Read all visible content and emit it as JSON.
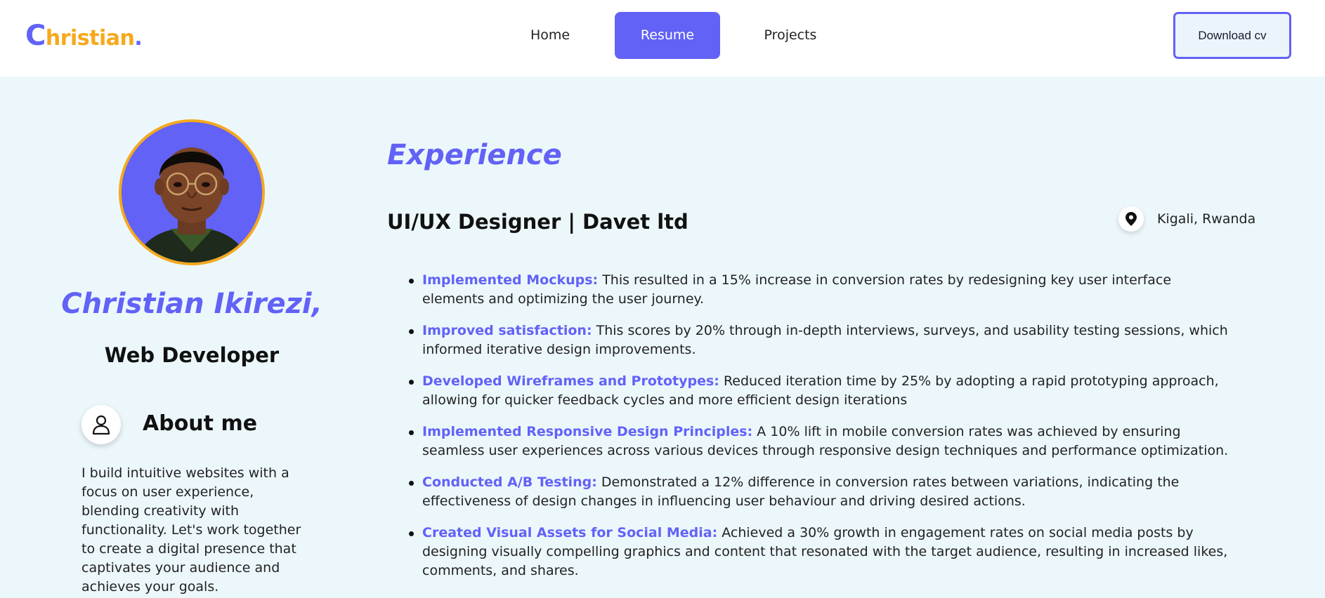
{
  "brand": {
    "logo_first": "C",
    "logo_rest": "hristian",
    "logo_dot": ".",
    "primary_color": "#6262f7",
    "accent_color": "#f5a91c"
  },
  "nav": {
    "items": [
      {
        "label": "Home",
        "active": false
      },
      {
        "label": "Resume",
        "active": true
      },
      {
        "label": "Projects",
        "active": false
      }
    ],
    "download_label": "Download cv"
  },
  "profile": {
    "name": "Christian Ikirezi,",
    "role": "Web Developer",
    "about_title": "About me",
    "about_text": "I build intuitive websites with a focus on user experience, blending creativity with functionality. Let's work together to create a digital presence that captivates your audience and achieves your goals.",
    "about_icon": "user-icon",
    "avatar": "profile-portrait"
  },
  "experience": {
    "title": "Experience",
    "job_title": "UI/UX Designer | Davet ltd",
    "location": "Kigali, Rwanda",
    "location_icon": "map-pin-icon",
    "items": [
      {
        "lead": "Implemented Mockups:",
        "text": " This resulted in a 15% increase in conversion rates by redesigning key user interface elements and optimizing the user journey."
      },
      {
        "lead": "Improved satisfaction:",
        "text": " This scores by 20% through in-depth interviews, surveys, and usability testing sessions, which informed iterative design improvements."
      },
      {
        "lead": "Developed Wireframes and Prototypes:",
        "text": " Reduced iteration time by 25% by adopting a rapid prototyping approach, allowing for quicker feedback cycles and more efficient design iterations"
      },
      {
        "lead": "Implemented Responsive Design Principles:",
        "text": " A 10% lift in mobile conversion rates was achieved by ensuring seamless user experiences across various devices through responsive design techniques and performance optimization."
      },
      {
        "lead": "Conducted A/B Testing:",
        "text": " Demonstrated a 12% difference in conversion rates between variations, indicating the effectiveness of design changes in influencing user behaviour and driving desired actions."
      },
      {
        "lead": "Created Visual Assets for Social Media:",
        "text": " Achieved a 30% growth in engagement rates on social media posts by designing visually compelling graphics and content that resonated with the target audience, resulting in increased likes, comments, and shares."
      }
    ]
  }
}
